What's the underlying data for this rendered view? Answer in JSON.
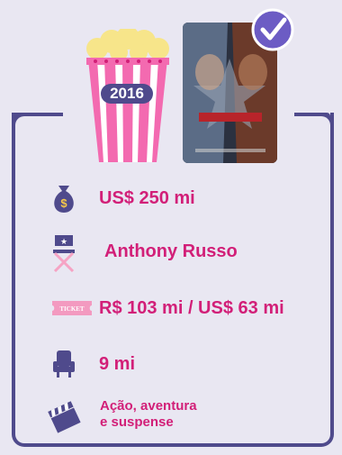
{
  "header": {
    "year": "2016"
  },
  "info": {
    "budget": "US$ 250 mi",
    "director": "Anthony Russo",
    "box_office": "R$ 103 mi / US$ 63 mi",
    "audience": "9 mi",
    "genre_line1": "Ação, aventura",
    "genre_line2": "e suspense",
    "ticket_label": "TICKET"
  },
  "colors": {
    "accent": "#d21f78",
    "frame": "#4f4a8c",
    "background": "#e9e7f2"
  }
}
